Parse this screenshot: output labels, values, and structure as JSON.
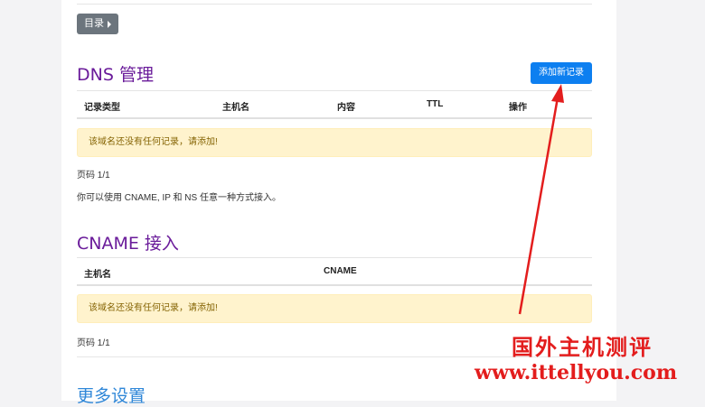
{
  "toc_button": {
    "label": "目录"
  },
  "dns": {
    "title": "DNS 管理",
    "add_button": "添加新记录",
    "columns": [
      "记录类型",
      "主机名",
      "内容",
      "TTL",
      "操作"
    ],
    "empty_message": "该域名还没有任何记录，请添加!",
    "page_label": "页码 1/1",
    "hint": "你可以使用 CNAME, IP 和 NS 任意一种方式接入。"
  },
  "cname": {
    "title": "CNAME 接入",
    "columns": [
      "主机名",
      "CNAME"
    ],
    "empty_message": "该域名还没有任何记录，请添加!",
    "page_label": "页码 1/1"
  },
  "more": {
    "title": "更多设置"
  },
  "watermark": {
    "line1": "国外主机测评",
    "line2": "www.ittellyou.com"
  },
  "colors": {
    "title_purple": "#6a1b9a",
    "primary_blue": "#0d7ff0",
    "alert_bg": "#fff3cd",
    "alert_text": "#856404",
    "annotation_red": "#e31d1d"
  }
}
